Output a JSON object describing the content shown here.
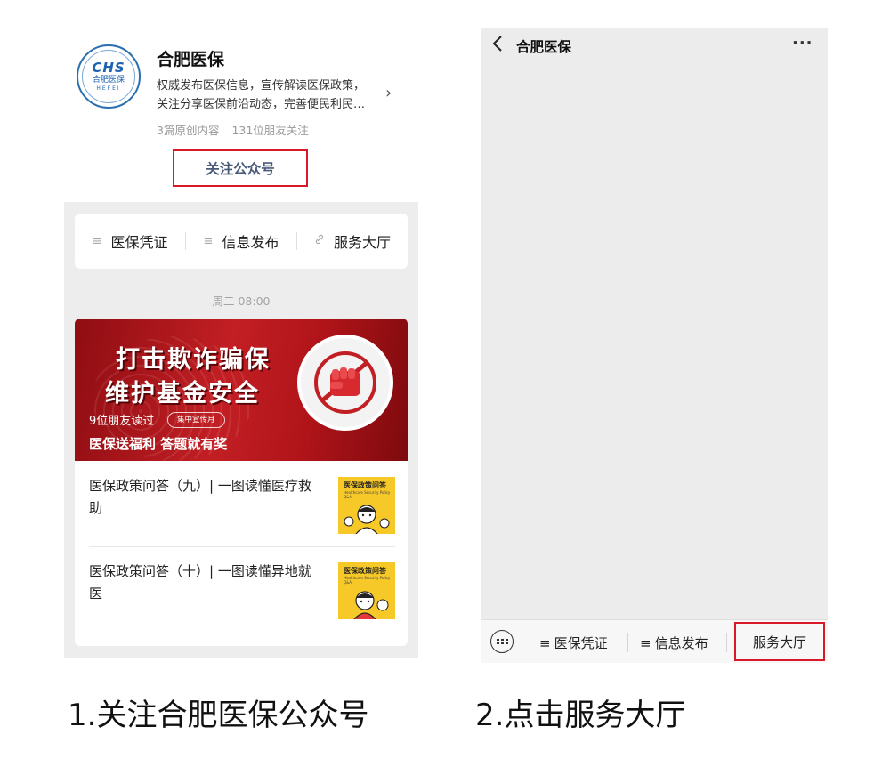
{
  "left_panel": {
    "logo": {
      "mark": "CHS",
      "cn": "合肥医保",
      "en": "HEFEI"
    },
    "account_name": "合肥医保",
    "description_line1": "权威发布医保信息，宣传解读医保政策，",
    "description_line2": "关注分享医保前沿动态，完善便民利民…",
    "stats_original": "3篇原创内容",
    "stats_followers": "131位朋友关注",
    "follow_button": "关注公众号",
    "menu": [
      {
        "icon": "≡",
        "label": "医保凭证"
      },
      {
        "icon": "≡",
        "label": "信息发布"
      },
      {
        "icon": "🔗",
        "label": "服务大厅"
      }
    ],
    "feed_time": "周二 08:00",
    "banner": {
      "line1": "打击欺诈骗保",
      "line2": "维护基金安全",
      "readers": "9位朋友读过",
      "tag": "集中宣传月",
      "title": "医保送福利 答题就有奖"
    },
    "articles": [
      {
        "title": "医保政策问答（九）| 一图读懂医疗救助",
        "thumb_title": "医保政策问答",
        "thumb_sub": "Healthcare Security Policy Q&A"
      },
      {
        "title": "医保政策问答（十）| 一图读懂异地就医",
        "thumb_title": "医保政策问答",
        "thumb_sub": "Healthcare Security Policy Q&A"
      }
    ]
  },
  "right_panel": {
    "title": "合肥医保",
    "back_icon": "chevron-left-icon",
    "more_icon": "···",
    "bottom_menu": [
      {
        "icon": "≡",
        "label": "医保凭证"
      },
      {
        "icon": "≡",
        "label": "信息发布"
      },
      {
        "icon": "",
        "label": "服务大厅"
      }
    ]
  },
  "captions": {
    "step1": "1.关注合肥医保公众号",
    "step2": "2.点击服务大厅"
  },
  "colors": {
    "highlight_red": "#d7192a",
    "banner_red": "#c21f24",
    "thumb_yellow": "#f7c928"
  }
}
